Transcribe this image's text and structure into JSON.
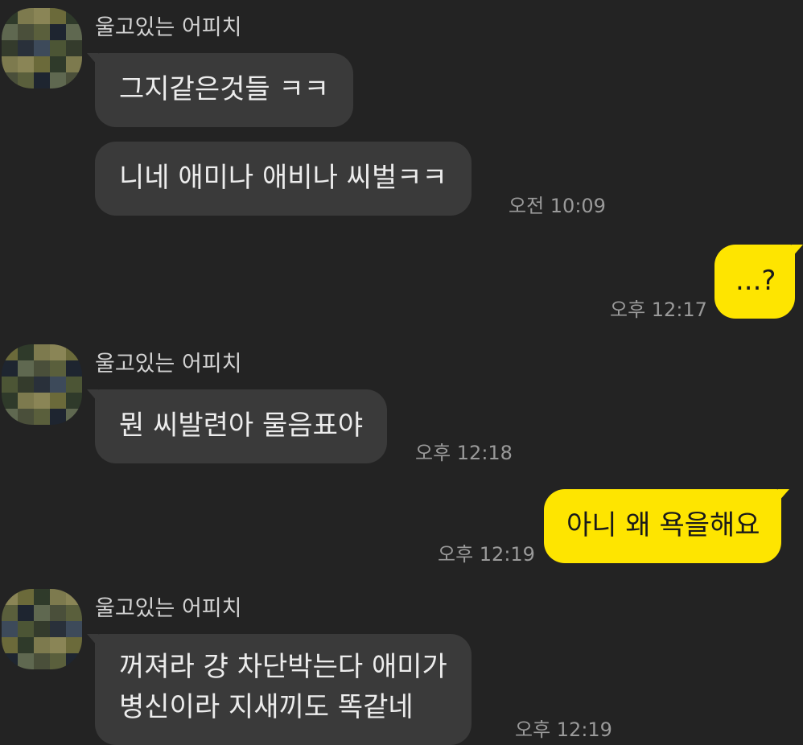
{
  "sender_name": "울고있는 어피치",
  "messages": {
    "m1": "그지같은것들 ㅋㅋ",
    "m2": "니네 애미나 애비나 씨벌ㅋㅋ",
    "m3": "...?",
    "m4": "뭔 씨발련아 물음표야",
    "m5": "아니 왜 욕을해요",
    "m6_line1": "꺼져라 걍 차단박는다 애미가",
    "m6_line2": "병신이라 지새끼도 똑같네"
  },
  "times": {
    "t1": "오전 10:09",
    "t2": "오후 12:17",
    "t3": "오후 12:18",
    "t4": "오후 12:19",
    "t5": "오후 12:19"
  },
  "colors": {
    "background": "#232323",
    "incoming_bubble": "#3a3a3a",
    "outgoing_bubble": "#fee500",
    "timestamp": "#9a9a9a"
  }
}
